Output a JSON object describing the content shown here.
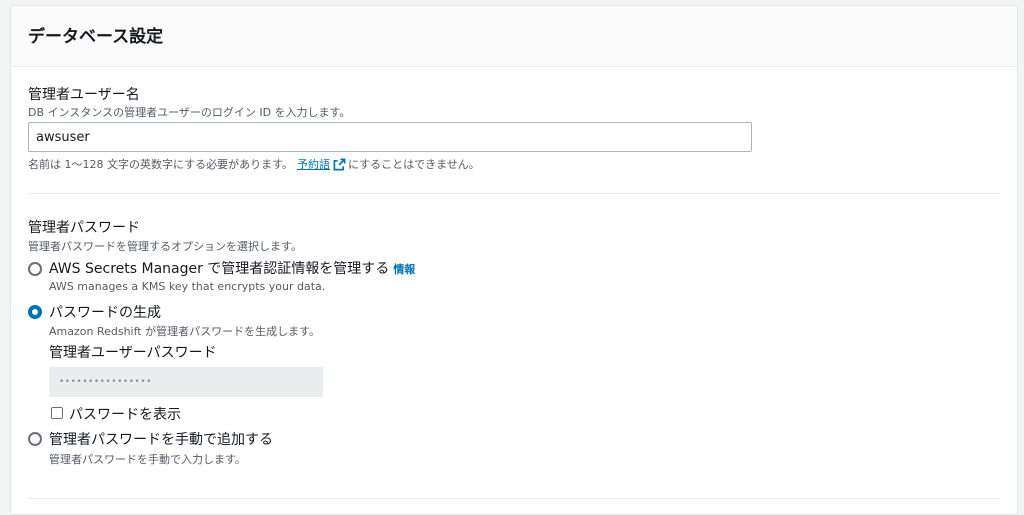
{
  "section": {
    "title": "データベース設定"
  },
  "username": {
    "label": "管理者ユーザー名",
    "description": "DB インスタンスの管理者ユーザーのログイン ID を入力します。",
    "value": "awsuser",
    "hint_before": "名前は 1～128 文字の英数字にする必要があります。",
    "hint_link": "予約語",
    "hint_after": "にすることはできません。"
  },
  "password": {
    "label": "管理者パスワード",
    "description": "管理者パスワードを管理するオプションを選択します。",
    "options": [
      {
        "label": "AWS Secrets Manager で管理者認証情報を管理する",
        "info": "情報",
        "description": "AWS manages a KMS key that encrypts your data.",
        "selected": false
      },
      {
        "label": "パスワードの生成",
        "description": "Amazon Redshift が管理者パスワードを生成します。",
        "selected": true
      },
      {
        "label": "管理者パスワードを手動で追加する",
        "description": "管理者パスワードを手動で入力します。",
        "selected": false
      }
    ],
    "generated_label": "管理者ユーザーパスワード",
    "generated_value": "••••••••••••••••",
    "show_password_label": "パスワードを表示",
    "show_password_checked": false
  }
}
